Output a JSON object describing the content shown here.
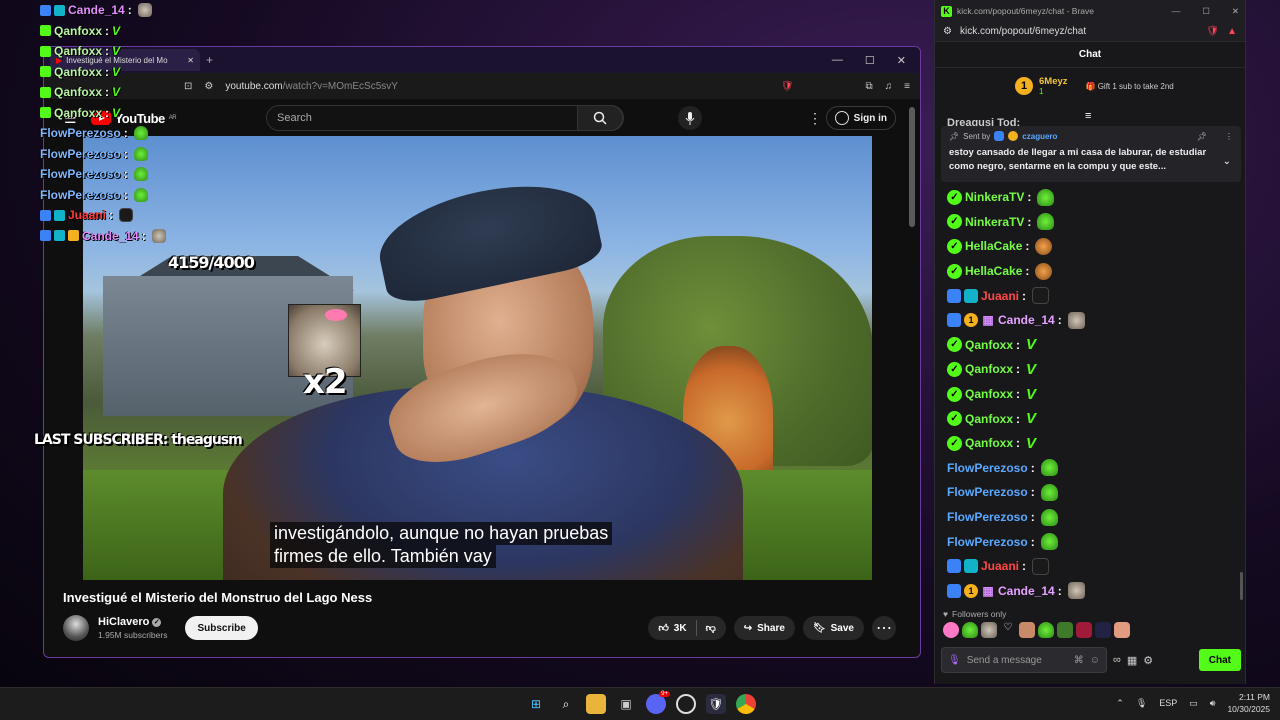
{
  "overlay_chat": [
    {
      "user": "Cande_14",
      "color": "pink",
      "badges": [
        "blue",
        "teal"
      ],
      "emote": "cat"
    },
    {
      "user": "Qanfoxx",
      "color": "green",
      "badges": [
        "green"
      ],
      "emote": "V"
    },
    {
      "user": "Qanfoxx",
      "color": "green",
      "badges": [
        "green"
      ],
      "emote": "V"
    },
    {
      "user": "Qanfoxx",
      "color": "green",
      "badges": [
        "green"
      ],
      "emote": "V"
    },
    {
      "user": "Qanfoxx",
      "color": "green",
      "badges": [
        "green"
      ],
      "emote": "V"
    },
    {
      "user": "Qanfoxx",
      "color": "green",
      "badges": [
        "green"
      ],
      "emote": "V"
    },
    {
      "user": "FlowPerezoso",
      "color": "blue",
      "badges": [],
      "emote": "green"
    },
    {
      "user": "FlowPerezoso",
      "color": "blue",
      "badges": [],
      "emote": "green"
    },
    {
      "user": "FlowPerezoso",
      "color": "blue",
      "badges": [],
      "emote": "green"
    },
    {
      "user": "FlowPerezoso",
      "color": "blue",
      "badges": [],
      "emote": "green"
    },
    {
      "user": "Juaani",
      "color": "red",
      "badges": [
        "blue",
        "teal"
      ],
      "emote": "dark"
    },
    {
      "user": "Cande_14",
      "color": "pink",
      "badges": [
        "blue",
        "teal",
        "gold"
      ],
      "emote": "cat"
    }
  ],
  "youtube": {
    "tab_title": "Investigué el Misterio del Mo",
    "url_host": "youtube.com",
    "url_path": "/watch?v=MOmEcSc5svY",
    "logo_text": "YouTube",
    "logo_region": "AR",
    "search_placeholder": "Search",
    "sign_in": "Sign in",
    "video": {
      "counter_text": "4159/4000",
      "multiplier_text": "x2",
      "last_subscriber": "LAST SUBSCRIBER: theagusm",
      "caption_line1": "investigándolo, aunque no hayan pruebas",
      "caption_line2": "firmes de ello. También vay"
    },
    "title": "Investigué el Misterio del Monstruo del Lago Ness",
    "channel_name": "HiClavero",
    "subscribers": "1.95M subscribers",
    "subscribe_label": "Subscribe",
    "likes": "3K",
    "share_label": "Share",
    "save_label": "Save"
  },
  "kick": {
    "window_title": "kick.com/popout/6meyz/chat - Brave",
    "url": "kick.com/popout/6meyz/chat",
    "header": "Chat",
    "gifter_name": "6Meyz",
    "gifter_count": "1",
    "gift_prompt": "Gift 1 sub to take 2nd",
    "partial_line": "Dreaqusi Tod:",
    "pinned_sent_by": "Sent by",
    "pinned_user": "czaguero",
    "pinned_message": "estoy cansado de llegar a mi casa de laburar, de estudiar como negro, sentarme en la compu y que este...",
    "messages": [
      {
        "user": "NinkeraTV",
        "color": "green",
        "verified": true,
        "badges": [],
        "emote": "green"
      },
      {
        "user": "NinkeraTV",
        "color": "green",
        "verified": true,
        "badges": [],
        "emote": "green"
      },
      {
        "user": "HellaCake",
        "color": "green",
        "verified": true,
        "badges": [],
        "emote": "cake"
      },
      {
        "user": "HellaCake",
        "color": "green",
        "verified": true,
        "badges": [],
        "emote": "cake"
      },
      {
        "user": "Juaani",
        "color": "red",
        "verified": false,
        "badges": [
          "blue",
          "teal"
        ],
        "emote": "dark"
      },
      {
        "user": "Cande_14",
        "color": "pink",
        "verified": false,
        "badges": [
          "blue",
          "gold",
          "gift"
        ],
        "emote": "cat"
      },
      {
        "user": "Qanfoxx",
        "color": "green",
        "verified": true,
        "badges": [],
        "emote": "V"
      },
      {
        "user": "Qanfoxx",
        "color": "green",
        "verified": true,
        "badges": [],
        "emote": "V"
      },
      {
        "user": "Qanfoxx",
        "color": "green",
        "verified": true,
        "badges": [],
        "emote": "V"
      },
      {
        "user": "Qanfoxx",
        "color": "green",
        "verified": true,
        "badges": [],
        "emote": "V"
      },
      {
        "user": "Qanfoxx",
        "color": "green",
        "verified": true,
        "badges": [],
        "emote": "V"
      },
      {
        "user": "FlowPerezoso",
        "color": "blue",
        "verified": false,
        "badges": [],
        "emote": "green"
      },
      {
        "user": "FlowPerezoso",
        "color": "blue",
        "verified": false,
        "badges": [],
        "emote": "green"
      },
      {
        "user": "FlowPerezoso",
        "color": "blue",
        "verified": false,
        "badges": [],
        "emote": "green"
      },
      {
        "user": "FlowPerezoso",
        "color": "blue",
        "verified": false,
        "badges": [],
        "emote": "green"
      },
      {
        "user": "Juaani",
        "color": "red",
        "verified": false,
        "badges": [
          "blue",
          "teal"
        ],
        "emote": "dark"
      },
      {
        "user": "Cande_14",
        "color": "pink",
        "verified": false,
        "badges": [
          "blue",
          "gold",
          "gift"
        ],
        "emote": "cat"
      }
    ],
    "followers_only": "Followers only",
    "input_placeholder": "Send a message",
    "send_label": "Chat"
  },
  "taskbar": {
    "discord_badge": "9+",
    "language": "ESP",
    "time": "2:11 PM",
    "date": "10/30/2025"
  },
  "colors": {
    "kick_green": "#53fc18",
    "yt_red": "#ff0000",
    "accent_purple": "#6b3aa0"
  }
}
